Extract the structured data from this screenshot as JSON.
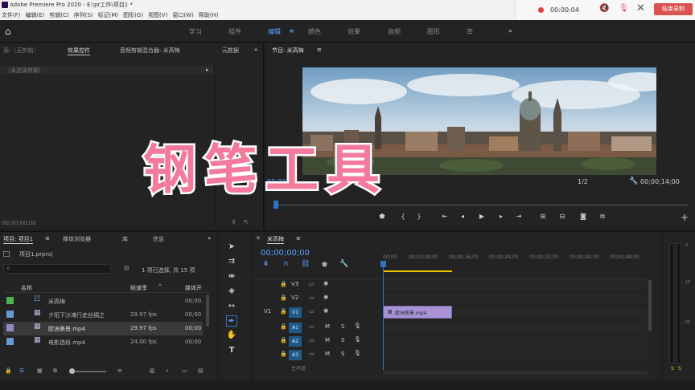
{
  "app": {
    "title": "Adobe Premiere Pro 2020 - E:\\pr工作\\项目1 *",
    "menu": [
      "文件(F)",
      "编辑(E)",
      "剪辑(C)",
      "序列(S)",
      "标记(M)",
      "图形(G)",
      "视图(V)",
      "窗口(W)",
      "帮助(H)"
    ]
  },
  "recorder": {
    "time": "00:00:04",
    "end_label": "结束录制"
  },
  "workspaces": [
    "学习",
    "组件",
    "编辑",
    "颜色",
    "效果",
    "音频",
    "图形",
    "库"
  ],
  "source_panel": {
    "tabs": [
      "源:（无剪辑）",
      "效果控件",
      "音频剪辑混合器: 米高梅",
      "元数据"
    ],
    "no_clip": "（未选择剪辑）",
    "timecode": "00;00;00;00"
  },
  "program": {
    "title": "节目: 米高梅",
    "timecode_left": "00;00;",
    "fit": "1/2",
    "timecode_right": "00;00;14;00"
  },
  "overlay_text": "钢笔工具",
  "project": {
    "tabs": [
      "项目: 项目1",
      "媒体浏览器",
      "库",
      "信息"
    ],
    "file": "项目1.prproj",
    "selection_info": "1 项已选择, 共 15 项",
    "columns": [
      "名称",
      "帧速率",
      "媒体开"
    ],
    "items": [
      {
        "name": "米高梅",
        "fps": "",
        "start": "00;00",
        "color": "#4fb24f"
      },
      {
        "name": "夕阳下沙滩行走丝绸之",
        "fps": "29.97 fps",
        "start": "00;00",
        "color": "#6a9ad6"
      },
      {
        "name": "欧洲美景.mp4",
        "fps": "29.97 fps",
        "start": "00;00",
        "color": "#9a86c8"
      },
      {
        "name": "电影选段.mp4",
        "fps": "24.00 fps",
        "start": "00;00",
        "color": "#6a9ad6"
      }
    ]
  },
  "timeline": {
    "tab": "米高梅",
    "timecode": "00;00;00;00",
    "ruler": [
      "00;00",
      "00;00;08;00",
      "00;00;16;00",
      "00;00;24;00",
      "00;00;32;00",
      "00;00;40;00",
      "00;00;48;00"
    ],
    "video_tracks": [
      "V3",
      "V2",
      "V1"
    ],
    "audio_tracks": [
      "A1",
      "A2",
      "A3"
    ],
    "source_patch": "V1",
    "clip_name": "欧洲美景.mp4",
    "last_row": "主声道"
  }
}
